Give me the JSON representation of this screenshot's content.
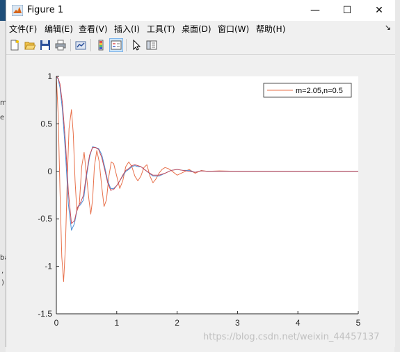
{
  "window": {
    "title": "Figure 1",
    "controls": {
      "minimize": "—",
      "maximize": "☐",
      "close": "✕"
    }
  },
  "menu": {
    "items": [
      "文件(F)",
      "编辑(E)",
      "查看(V)",
      "插入(I)",
      "工具(T)",
      "桌面(D)",
      "窗口(W)",
      "帮助(H)"
    ]
  },
  "toolbar": {
    "buttons": [
      "new-figure-icon",
      "open-file-icon",
      "save-icon",
      "print-icon",
      "link-plot-icon",
      "colorbar-icon",
      "legend-icon",
      "pointer-icon",
      "property-editor-icon"
    ],
    "active": "legend-icon"
  },
  "background_fragments": [
    "m",
    "e",
    "ba",
    ",",
    ")"
  ],
  "watermark": "https://blog.csdn.net/weixin_44457137",
  "chart_data": {
    "type": "line",
    "xlim": [
      0,
      5
    ],
    "ylim": [
      -1.5,
      1
    ],
    "xticks": [
      "0",
      "1",
      "2",
      "3",
      "4",
      "5"
    ],
    "yticks": [
      "1",
      "0.5",
      "0",
      "-0.5",
      "-1",
      "-1.5"
    ],
    "xtick_values": [
      0,
      1,
      2,
      3,
      4,
      5
    ],
    "ytick_values": [
      1,
      0.5,
      0,
      -0.5,
      -1,
      -1.5
    ],
    "grid": false,
    "legend_position": "top-right",
    "series": [
      {
        "name": "m=2.05,n=0.5",
        "color": "#e8704a",
        "x": [
          0,
          0.03,
          0.06,
          0.09,
          0.12,
          0.15,
          0.18,
          0.21,
          0.25,
          0.28,
          0.31,
          0.34,
          0.38,
          0.42,
          0.46,
          0.5,
          0.54,
          0.57,
          0.6,
          0.63,
          0.67,
          0.71,
          0.75,
          0.79,
          0.83,
          0.87,
          0.91,
          0.95,
          1.0,
          1.05,
          1.1,
          1.15,
          1.2,
          1.25,
          1.3,
          1.35,
          1.4,
          1.45,
          1.5,
          1.55,
          1.6,
          1.65,
          1.7,
          1.75,
          1.8,
          1.85,
          1.9,
          2.0,
          2.1,
          2.2,
          2.3,
          2.4,
          2.5,
          2.7,
          3.0,
          3.5,
          4.0,
          5.0
        ],
        "y": [
          1.0,
          0.6,
          -0.2,
          -0.9,
          -1.16,
          -0.8,
          -0.1,
          0.45,
          0.65,
          0.4,
          -0.1,
          -0.42,
          -0.35,
          0.05,
          0.2,
          -0.05,
          -0.3,
          -0.45,
          -0.3,
          0.05,
          0.22,
          0.1,
          -0.15,
          -0.37,
          -0.3,
          -0.05,
          0.1,
          0.08,
          -0.05,
          -0.18,
          -0.1,
          0.05,
          0.1,
          0.05,
          -0.05,
          -0.1,
          -0.05,
          0.04,
          0.07,
          -0.05,
          -0.12,
          -0.08,
          -0.02,
          0.02,
          0.04,
          0.03,
          0.01,
          -0.04,
          -0.01,
          0.02,
          -0.02,
          0.01,
          0.0,
          0.005,
          0.0,
          0.0,
          0.0,
          0.0
        ]
      },
      {
        "color": "#4a8fd6",
        "x": [
          0,
          0.03,
          0.06,
          0.1,
          0.15,
          0.2,
          0.25,
          0.3,
          0.35,
          0.4,
          0.45,
          0.5,
          0.55,
          0.6,
          0.65,
          0.7,
          0.75,
          0.8,
          0.85,
          0.9,
          0.95,
          1.0,
          1.05,
          1.1,
          1.15,
          1.2,
          1.25,
          1.3,
          1.35,
          1.4,
          1.5,
          1.6,
          1.7,
          1.8,
          1.9,
          2.0,
          2.1,
          2.2,
          2.3,
          2.4,
          2.5,
          2.7,
          3.0,
          3.5,
          4.0,
          5.0
        ],
        "y": [
          1.0,
          0.97,
          0.88,
          0.65,
          0.2,
          -0.35,
          -0.62,
          -0.55,
          -0.38,
          -0.35,
          -0.3,
          -0.05,
          0.15,
          0.26,
          0.25,
          0.24,
          0.18,
          0.05,
          -0.1,
          -0.18,
          -0.18,
          -0.15,
          -0.1,
          -0.05,
          0.0,
          0.02,
          0.05,
          0.06,
          0.05,
          0.05,
          0.0,
          -0.05,
          -0.05,
          -0.02,
          0.01,
          0.02,
          0.01,
          0.01,
          -0.01,
          0.005,
          0.0,
          0.0,
          0.0,
          0.0,
          0.0,
          0.0
        ]
      },
      {
        "color": "#c94a58",
        "x": [
          0,
          0.03,
          0.06,
          0.1,
          0.15,
          0.2,
          0.25,
          0.3,
          0.35,
          0.4,
          0.45,
          0.5,
          0.55,
          0.6,
          0.65,
          0.7,
          0.75,
          0.8,
          0.85,
          0.9,
          0.95,
          1.0,
          1.05,
          1.1,
          1.15,
          1.2,
          1.25,
          1.3,
          1.35,
          1.4,
          1.5,
          1.6,
          1.7,
          1.8,
          1.9,
          2.0,
          2.1,
          2.2,
          2.3,
          2.4,
          2.5,
          2.7,
          3.0,
          3.5,
          4.0,
          5.0
        ],
        "y": [
          1.0,
          0.98,
          0.92,
          0.72,
          0.32,
          -0.22,
          -0.55,
          -0.52,
          -0.38,
          -0.33,
          -0.25,
          -0.02,
          0.17,
          0.25,
          0.25,
          0.23,
          0.15,
          0.02,
          -0.12,
          -0.2,
          -0.19,
          -0.15,
          -0.1,
          -0.04,
          0.01,
          0.03,
          0.06,
          0.07,
          0.06,
          0.05,
          0.0,
          -0.04,
          -0.04,
          -0.02,
          0.01,
          0.02,
          0.01,
          0.0,
          -0.01,
          0.005,
          0.0,
          0.0,
          0.0,
          0.0,
          0.0,
          0.0
        ]
      }
    ]
  }
}
